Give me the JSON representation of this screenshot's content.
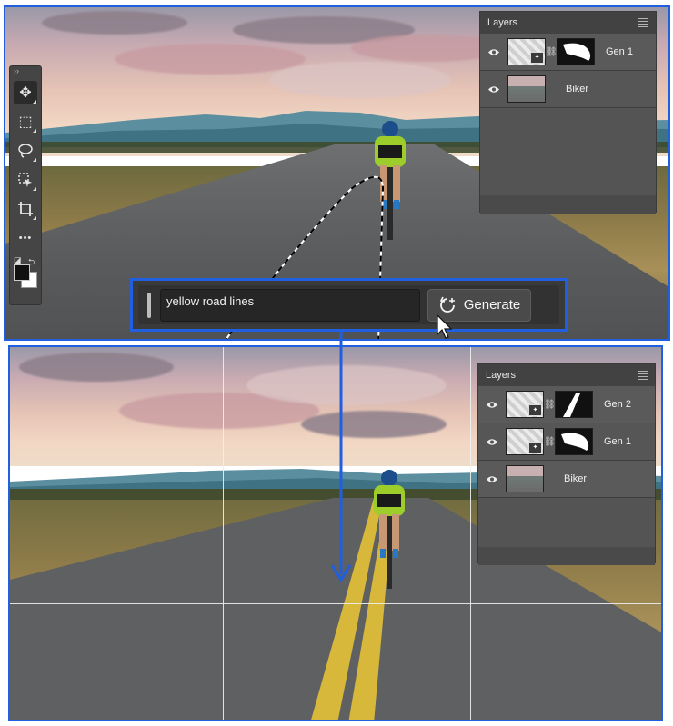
{
  "toolbar": {
    "tools": [
      {
        "icon": "move-icon",
        "glyph": "✥",
        "active": true
      },
      {
        "icon": "rectangular-marquee-icon",
        "glyph": "⬚"
      },
      {
        "icon": "lasso-icon",
        "glyph": "◌"
      },
      {
        "icon": "object-selection-icon",
        "glyph": "⬕"
      },
      {
        "icon": "crop-icon",
        "glyph": "⌗"
      },
      {
        "icon": "more-tools-icon",
        "glyph": "•••"
      }
    ]
  },
  "top_panel": {
    "title": "Layers",
    "layers": [
      {
        "name": "Gen 1"
      },
      {
        "name": "Biker"
      }
    ]
  },
  "bottom_panel": {
    "title": "Layers",
    "layers": [
      {
        "name": "Gen 2"
      },
      {
        "name": "Gen 1"
      },
      {
        "name": "Biker"
      }
    ]
  },
  "prompt": {
    "value": "yellow road lines",
    "generate_label": "Generate"
  },
  "colors": {
    "accent": "#1f5fe0",
    "panel": "#525252",
    "toolbar": "#454545"
  }
}
